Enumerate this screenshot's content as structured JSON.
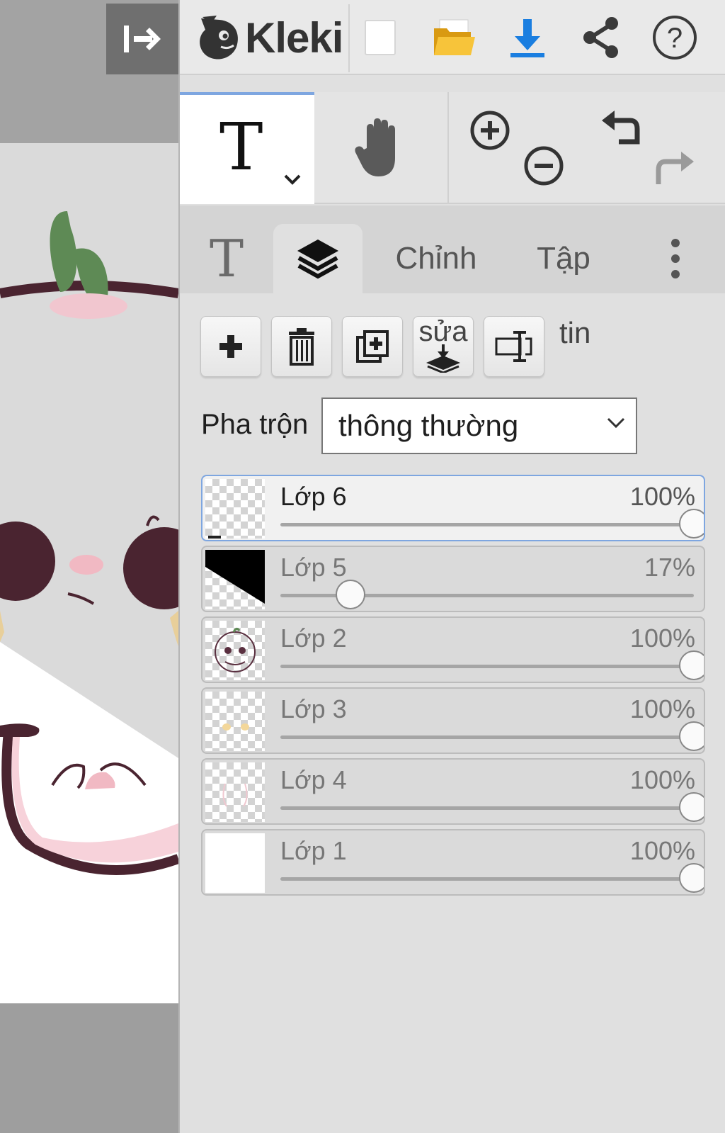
{
  "app": {
    "name": "Kleki"
  },
  "toolbar": {
    "icons": [
      "new-image-icon",
      "open-folder-icon",
      "download-icon",
      "share-icon",
      "help-icon"
    ],
    "accent_color": "#1a7ee0"
  },
  "tools": {
    "active": "text",
    "items": [
      "text-tool-icon",
      "hand-tool-icon",
      "zoom-in-icon",
      "zoom-out-icon",
      "undo-icon",
      "redo-icon"
    ]
  },
  "tabs": {
    "text_tab_glyph": "T",
    "edit": "Chỉnh",
    "file": "Tập",
    "active": "layers"
  },
  "layer_actions": {
    "merge_label": "sửa",
    "info_label": "tin"
  },
  "blend": {
    "label": "Pha trộn",
    "value": "thông thường"
  },
  "layers": [
    {
      "name": "Lớp 6",
      "opacity_label": "100%",
      "opacity": 1.0,
      "selected": true
    },
    {
      "name": "Lớp 5",
      "opacity_label": "17%",
      "opacity": 0.17,
      "selected": false
    },
    {
      "name": "Lớp 2",
      "opacity_label": "100%",
      "opacity": 1.0,
      "selected": false
    },
    {
      "name": "Lớp 3",
      "opacity_label": "100%",
      "opacity": 1.0,
      "selected": false
    },
    {
      "name": "Lớp 4",
      "opacity_label": "100%",
      "opacity": 1.0,
      "selected": false
    },
    {
      "name": "Lớp 1",
      "opacity_label": "100%",
      "opacity": 1.0,
      "selected": false
    }
  ]
}
